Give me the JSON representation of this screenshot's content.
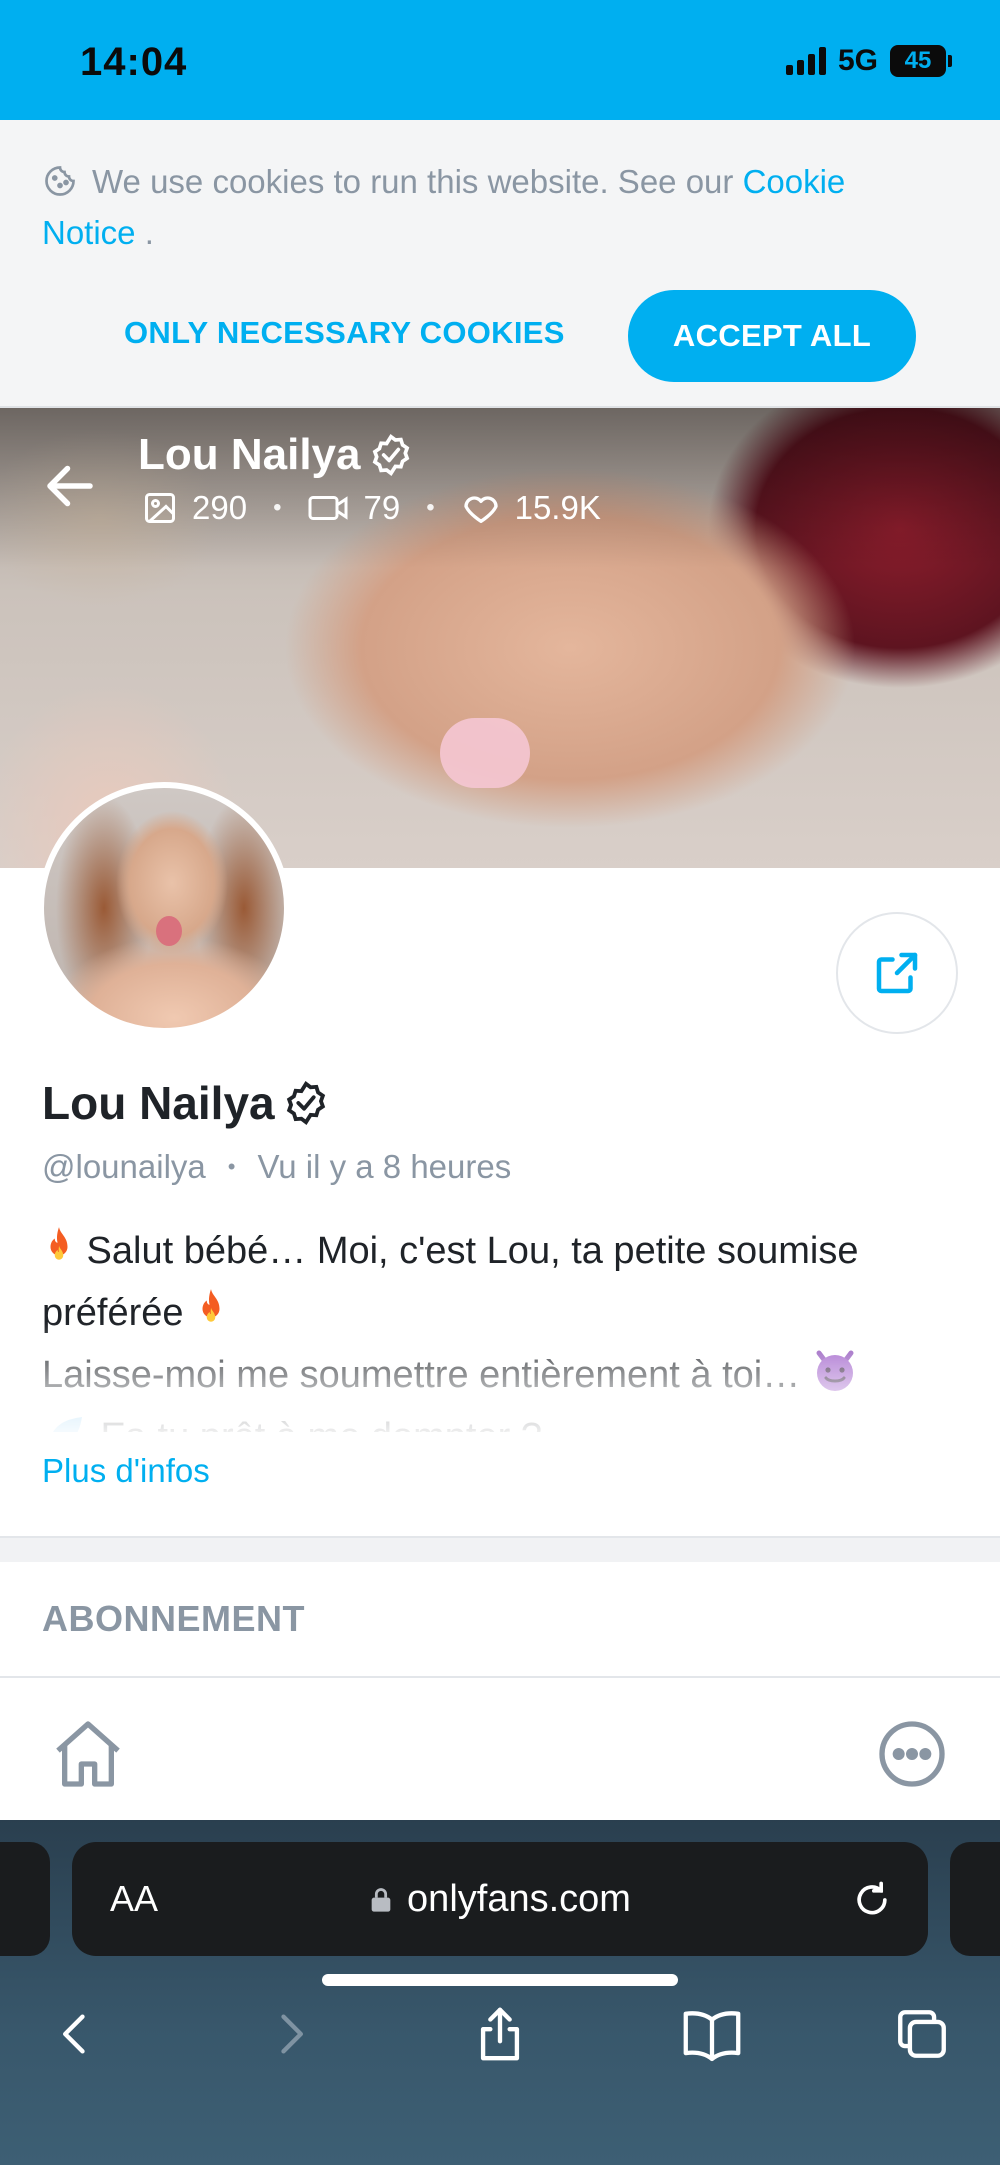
{
  "status_bar": {
    "time": "14:04",
    "network": "5G",
    "battery": "45"
  },
  "cookie_banner": {
    "text": "We use cookies to run this website. See our",
    "link_text": "Cookie Notice",
    "trailing": " .",
    "necessary_label": "ONLY NECESSARY COOKIES",
    "accept_label": "ACCEPT ALL"
  },
  "cover": {
    "name": "Lou Nailya",
    "stats": {
      "images": "290",
      "videos": "79",
      "likes": "15.9K"
    }
  },
  "profile": {
    "name": "Lou Nailya",
    "handle": "@lounailya",
    "last_seen": "Vu  il y a 8 heures",
    "bio_line1": " Salut bébé… Moi, c'est Lou, ta petite soumise préférée",
    "bio_line2": "Laisse-moi me soumettre entièrement à toi… ",
    "bio_line3": " Es-tu prêt à me dompter ?",
    "more_link": "Plus d'infos"
  },
  "sections": {
    "subscription_title": "ABONNEMENT"
  },
  "browser": {
    "text_size_label": "AA",
    "url": "onlyfans.com"
  },
  "colors": {
    "accent": "#00aff0",
    "muted": "#8a96a3",
    "text": "#1f2328",
    "safari_bar": "#1a1c1e"
  },
  "icons": {
    "cookie": "cookie-icon",
    "back": "arrow-left-icon",
    "verified": "verified-badge-icon",
    "image": "image-icon",
    "video": "video-icon",
    "heart": "heart-icon",
    "share": "share-icon",
    "home": "home-icon",
    "more": "more-icon",
    "lock": "lock-icon",
    "reload": "reload-icon"
  }
}
